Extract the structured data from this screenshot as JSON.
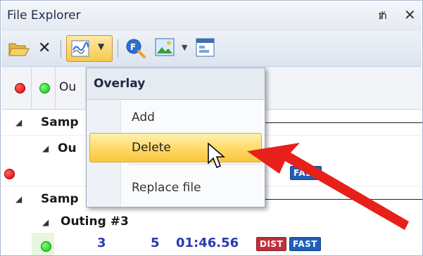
{
  "panel": {
    "title": "File Explorer",
    "pin_icon": "pin-icon",
    "close_icon": "close-icon"
  },
  "toolbar": {
    "buttons": [
      "open-folder-icon",
      "delete-x-icon",
      "overlay-icon",
      "dropdown-arrow",
      "find-icon",
      "image-icon",
      "dropdown-arrow",
      "report-icon"
    ]
  },
  "header": {
    "column_label": "Ou"
  },
  "menu": {
    "title": "Overlay",
    "items": [
      "Add",
      "Delete",
      "Replace file"
    ],
    "highlighted": "Delete"
  },
  "tree": {
    "rows": [
      {
        "label": "Samp"
      },
      {
        "label": "Ou"
      },
      {
        "badge": "FAST"
      },
      {
        "label": "Samp"
      },
      {
        "label": "Outing #3"
      },
      {
        "col1": "3",
        "col2": "5",
        "time": "01:46.56",
        "badges": [
          "DIST",
          "FAST"
        ]
      }
    ]
  },
  "colors": {
    "accent_red": "#e00000",
    "accent_green": "#12c412",
    "highlight": "#ffd966",
    "arrow": "#e8201a"
  }
}
